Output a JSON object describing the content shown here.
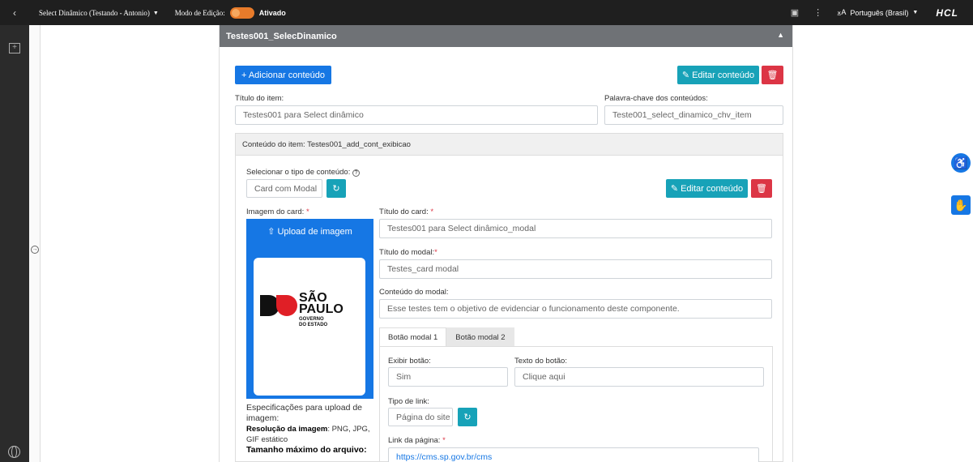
{
  "topbar": {
    "site_name": "Select Dinâmico (Testando - Antonio)",
    "edit_mode_label": "Modo de Edição:",
    "edit_mode_state": "Ativado",
    "language": "Português (Brasil)",
    "brand": "HCL"
  },
  "panel": {
    "title": "Testes001_SelecDinamico",
    "add_content_button": "+ Adicionar conteúdo",
    "edit_content_button": "Editar conteúdo",
    "item_title_label": "Título do item:",
    "item_title_value": "Testes001 para Select dinâmico",
    "keyword_label": "Palavra-chave dos conteúdos:",
    "keyword_value": "Teste001_select_dinamico_chv_item"
  },
  "content": {
    "header": "Conteúdo do item: Testes001_add_cont_exibicao",
    "type_label": "Selecionar o tipo de conteúdo:",
    "type_value": "Card com Modal",
    "edit_content_button": "Editar conteúdo",
    "image_label": "Imagem do card:",
    "upload_button": "Upload de imagem",
    "card_title_label": "Título do card:",
    "card_title_value": "Testes001 para Select dinâmico_modal",
    "modal_title_label": "Título do modal:",
    "modal_title_value": "Testes_card modal",
    "modal_content_label": "Conteúdo do modal:",
    "modal_content_value": "Esse testes tem o objetivo de evidenciar o funcionamento deste componente.",
    "spec_intro": "Especificações para upload de imagem:",
    "spec_resolution_label": "Resolução da imagem",
    "spec_resolution_value": ": PNG, JPG, GIF estático",
    "spec_size_label": "Tamanho máximo do arquivo:",
    "logo": {
      "line1": "SÃO",
      "line2": "PAULO",
      "line3": "GOVERNO",
      "line4": "DO ESTADO"
    }
  },
  "tabs": [
    {
      "label": "Botão modal 1"
    },
    {
      "label": "Botão modal 2"
    }
  ],
  "button_modal": {
    "show_label": "Exibir botão:",
    "show_value": "Sim",
    "text_label": "Texto do botão:",
    "text_value": "Clique aqui",
    "link_type_label": "Tipo de link:",
    "link_type_value": "Página do site",
    "page_link_label": "Link da página:",
    "page_link_value": "https://cms.sp.gov.br/cms"
  }
}
